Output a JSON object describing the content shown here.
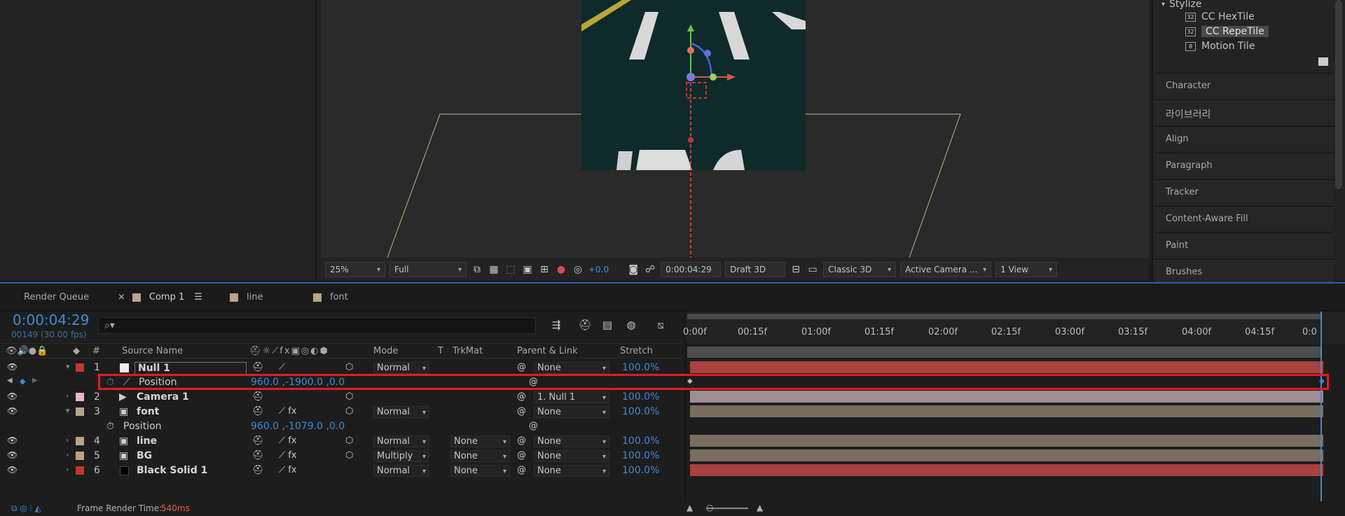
{
  "viewer": {
    "zoom": "25%",
    "resolution": "Full",
    "exposure": "+0.0",
    "timecode": "0:00:04:29",
    "draft": "Draft 3D",
    "renderer": "Classic 3D",
    "camera": "Active Camera ...",
    "views": "1 View"
  },
  "right_panel": {
    "category": "Stylize",
    "effects": [
      "CC HexTile",
      "CC RepeTile",
      "Motion Tile"
    ],
    "selected_effect_index": 1,
    "sections": [
      "Character",
      "라이브러리",
      "Align",
      "Paragraph",
      "Tracker",
      "Content-Aware Fill",
      "Paint",
      "Brushes"
    ]
  },
  "tabs": {
    "render_queue": "Render Queue",
    "close": "×",
    "comp": "Comp 1",
    "menu": "☰",
    "line": "line",
    "font": "font"
  },
  "timeline": {
    "timecode": "0:00:04:29",
    "fps": "00149 (30.00 fps)",
    "search_glyph": "⌕▾",
    "col_source": "Source Name",
    "col_num": "#",
    "col_mode": "Mode",
    "col_t": "T",
    "col_trkmat": "TrkMat",
    "col_parent": "Parent & Link",
    "col_stretch": "Stretch",
    "ruler_labels": [
      "0:00f",
      "00:15f",
      "01:00f",
      "01:15f",
      "02:00f",
      "02:15f",
      "03:00f",
      "03:15f",
      "04:00f",
      "04:15f",
      "0:0"
    ],
    "layers": [
      {
        "num": "1",
        "name": "Null 1",
        "mode": "Normal",
        "trkmat": "",
        "parent": "None",
        "stretch": "100.0%",
        "color": "#c0392b",
        "bar": "#a8413f"
      },
      {
        "prop": "Position",
        "value": "960.0 ,-1900.0 ,0.0"
      },
      {
        "num": "2",
        "name": "Camera 1",
        "mode": "",
        "trkmat": "",
        "parent": "1. Null 1",
        "stretch": "100.0%",
        "color": "#e6b8c2",
        "bar": "#9f8d94"
      },
      {
        "num": "3",
        "name": "font",
        "mode": "Normal",
        "trkmat": "",
        "parent": "None",
        "stretch": "100.0%",
        "color": "#b9a487",
        "bar": "#7a6c5e"
      },
      {
        "prop": "Position",
        "value": "960.0 ,-1079.0 ,0.0"
      },
      {
        "num": "4",
        "name": "line",
        "mode": "Normal",
        "trkmat": "None",
        "parent": "None",
        "stretch": "100.0%",
        "color": "#b9a487",
        "bar": "#7a6c5e"
      },
      {
        "num": "5",
        "name": "BG",
        "mode": "Multiply",
        "trkmat": "None",
        "parent": "None",
        "stretch": "100.0%",
        "color": "#b9a487",
        "bar": "#7a6c5e"
      },
      {
        "num": "6",
        "name": "Black Solid 1",
        "mode": "Normal",
        "trkmat": "None",
        "parent": "None",
        "stretch": "100.0%",
        "color": "#c0392b",
        "bar": "#a8413f"
      }
    ]
  },
  "status": {
    "label": "Frame Render Time:",
    "value": "540ms"
  }
}
